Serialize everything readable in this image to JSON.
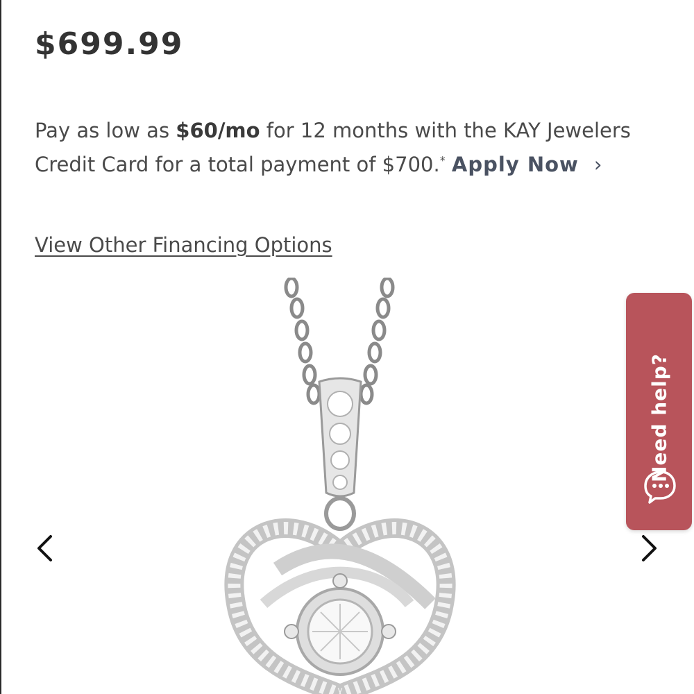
{
  "price": "$699.99",
  "financing": {
    "pre": "Pay as low as ",
    "rate": "$60/mo",
    "mid": " for 12 months with the KAY Jewelers Credit Card for a total payment of $700.",
    "asterisk": "*",
    "apply_label": "Apply Now",
    "apply_chevron": "›"
  },
  "other_options_label": "View Other Financing Options",
  "gallery": {
    "prev_icon": "chevron-left-icon",
    "next_icon": "chevron-right-icon",
    "image": "diamond-pendant-necklace"
  },
  "help": {
    "label": "Need help?",
    "icon": "chat-bubble-icon",
    "color": "#b8545b"
  }
}
